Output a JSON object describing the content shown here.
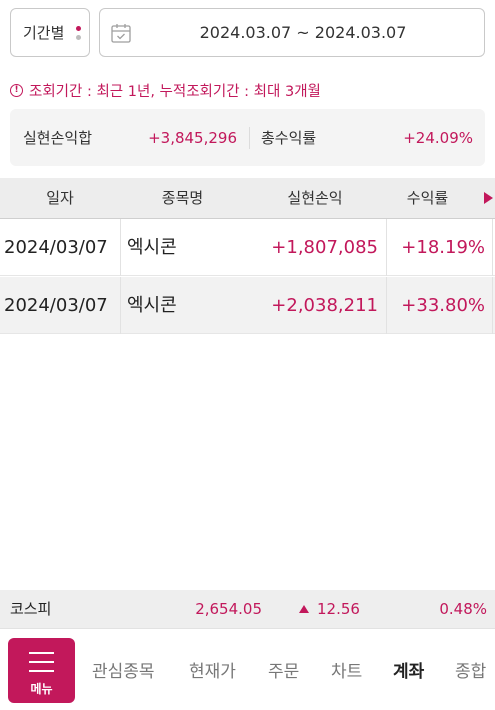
{
  "colors": {
    "accent": "#c2185b",
    "header_bg": "#ededed",
    "summary_bg": "#f4f4f4"
  },
  "filter": {
    "period_label": "기간별",
    "date_range": "2024.03.07 ~ 2024.03.07",
    "calendar_icon": "calendar-icon"
  },
  "notice": {
    "text": "조회기간 : 최근 1년, 누적조회기간 : 최대 3개월"
  },
  "summary": {
    "realized_label": "실현손익합",
    "realized_value": "+3,845,296",
    "rate_label": "총수익률",
    "rate_value": "+24.09%"
  },
  "table": {
    "headers": [
      "일자",
      "종목명",
      "실현손익",
      "수익률"
    ],
    "rows": [
      {
        "date": "2024/03/07",
        "name": "엑시콘",
        "profit": "+1,807,085",
        "rate": "+18.19%"
      },
      {
        "date": "2024/03/07",
        "name": "엑시콘",
        "profit": "+2,038,211",
        "rate": "+33.80%"
      }
    ]
  },
  "index_bar": {
    "name": "코스피",
    "price": "2,654.05",
    "change": "12.56",
    "rate": "0.48%"
  },
  "bottom_nav": {
    "menu_label": "메뉴",
    "items": [
      "관심종목",
      "현재가",
      "주문",
      "차트",
      "계좌",
      "종합"
    ]
  }
}
